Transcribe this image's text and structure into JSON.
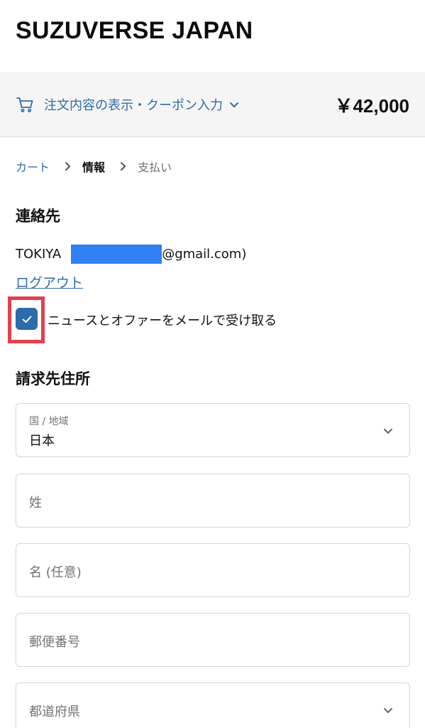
{
  "header": {
    "store_name": "SUZUVERSE JAPAN"
  },
  "order_summary": {
    "toggle_label": "注文内容の表示・クーポン入力",
    "total": "￥42,000",
    "icons": {
      "cart": "cart-icon",
      "expand": "chevron-down-icon"
    }
  },
  "breadcrumb": {
    "items": [
      {
        "label": "カート",
        "state": "link"
      },
      {
        "label": "情報",
        "state": "current"
      },
      {
        "label": "支払い",
        "state": "upcoming"
      }
    ]
  },
  "contact": {
    "title": "連絡先",
    "name": "TOKIYA",
    "email_suffix": "@gmail.com)",
    "logout_label": "ログアウト",
    "newsletter_label": "ニュースとオファーをメールで受け取る",
    "newsletter_checked": true
  },
  "billing": {
    "title": "請求先住所",
    "country": {
      "label": "国 / 地域",
      "value": "日本"
    },
    "last_name": {
      "placeholder": "姓"
    },
    "first_name": {
      "placeholder": "名 (任意)"
    },
    "postal_code": {
      "placeholder": "郵便番号"
    },
    "prefecture": {
      "placeholder": "都道府県"
    }
  },
  "colors": {
    "link": "#2f6ba8",
    "checkbox": "#2d6ba9",
    "highlight": "#e2414d",
    "redaction": "#2f7ff5",
    "summary_bg": "#f5f5f5"
  }
}
